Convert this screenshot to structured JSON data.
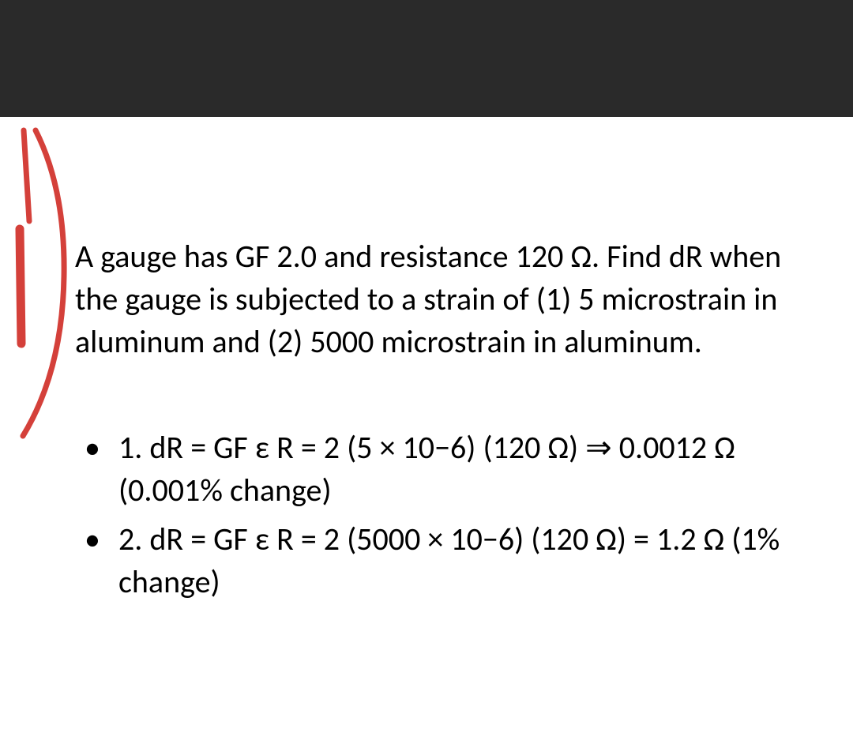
{
  "problem": "A gauge has GF 2.0 and resistance 120 Ω. Find dR when the gauge is subjected to a strain of (1) 5 microstrain in aluminum and (2) 5000 microstrain in aluminum.",
  "solutions": [
    "1. dR = GF ε R = 2 (5 × 10−6) (120 Ω) ⇒ 0.0012 Ω (0.001% change)",
    "2. dR = GF ε R = 2 (5000 × 10−6) (120 Ω) = 1.2 Ω (1% change)"
  ],
  "annotation_color": "#d4403a"
}
